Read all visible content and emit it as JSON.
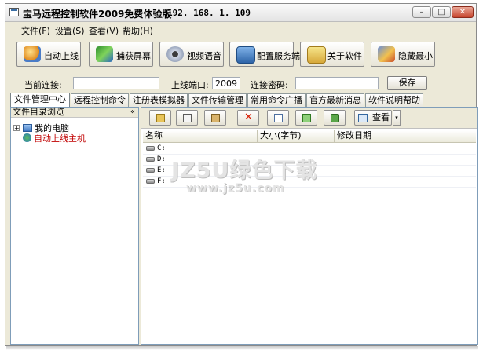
{
  "window": {
    "title": "宝马远程控制软件2009免费体验版",
    "ip": "192. 168. 1. 109",
    "controls": {
      "minimize": "–",
      "maximize": "□",
      "close": "✕"
    }
  },
  "menu": [
    {
      "label": "文件(F)"
    },
    {
      "label": "设置(S)"
    },
    {
      "label": "查看(V)"
    },
    {
      "label": "帮助(H)"
    }
  ],
  "toolbar": {
    "buttons": [
      {
        "label": "自动上线",
        "icon": "user-online-icon"
      },
      {
        "label": "捕获屏幕",
        "icon": "screen-capture-icon"
      },
      {
        "label": "视频语音",
        "icon": "webcam-icon"
      },
      {
        "label": "配置服务端",
        "icon": "config-server-icon"
      },
      {
        "label": "关于软件",
        "icon": "about-icon"
      },
      {
        "label": "隐藏最小",
        "icon": "hide-minimize-icon"
      }
    ]
  },
  "connection": {
    "current_label": "当前连接:",
    "current_value": "",
    "port_label": "上线端口:",
    "port_value": "2009",
    "password_label": "连接密码:",
    "password_value": "",
    "save_label": "保存"
  },
  "tabs": [
    {
      "label": "文件管理中心",
      "active": true
    },
    {
      "label": "远程控制命令"
    },
    {
      "label": "注册表模拟器"
    },
    {
      "label": "文件传输管理"
    },
    {
      "label": "常用命令广播"
    },
    {
      "label": "官方最新消息"
    },
    {
      "label": "软件说明帮助"
    }
  ],
  "file_tree": {
    "header": "文件目录浏览",
    "collapse": "«",
    "items": [
      {
        "label": "我的电脑",
        "expander": "+",
        "icon": "computer-icon"
      },
      {
        "label": "自动上线主机",
        "icon": "globe-host-icon",
        "color": "#c00000"
      }
    ]
  },
  "file_toolbar": {
    "icons": [
      "up-folder-icon",
      "copy-icon",
      "paste-icon",
      "delete-icon",
      "new-file-icon",
      "download-icon",
      "refresh-icon"
    ],
    "view_label": "查看",
    "view_dropdown": "▾"
  },
  "file_list": {
    "columns": [
      "名称",
      "大小(字节)",
      "修改日期"
    ],
    "rows": [
      {
        "name": "C:"
      },
      {
        "name": "D:"
      },
      {
        "name": "E:"
      },
      {
        "name": "F:"
      }
    ]
  },
  "watermark": {
    "main": "JZ5U绿色下载",
    "sub": "www.jz5u.com"
  },
  "colors": {
    "window_bg": "#ece9d8",
    "red_text": "#c00000",
    "delete_red": "#d81e06"
  }
}
